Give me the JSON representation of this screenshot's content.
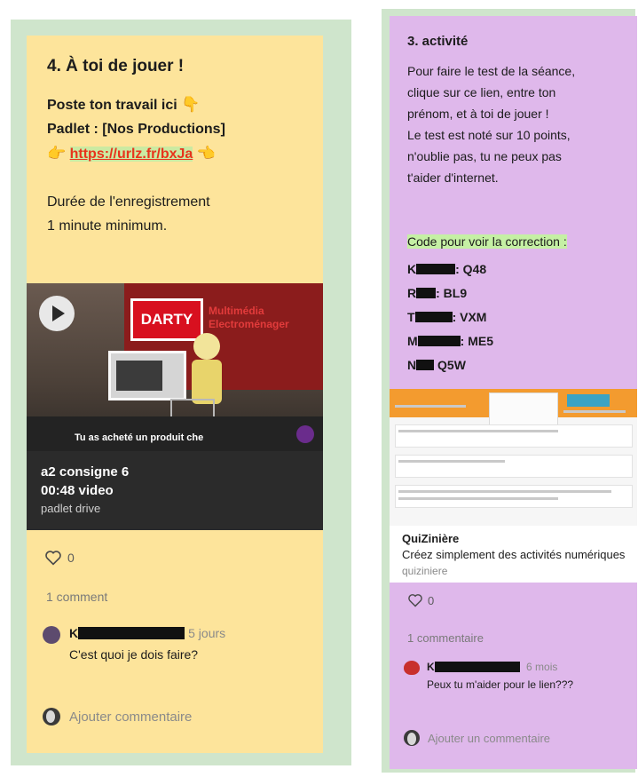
{
  "left_card": {
    "title": "4. À toi de jouer !",
    "line1": "Poste ton travail ici",
    "line2": "Padlet : [Nos Productions]",
    "link": "https://urlz.fr/bxJa",
    "duration_line1": "Durée de l'enregistrement",
    "duration_line2": "1 minute minimum.",
    "video": {
      "store_logo": "DARTY",
      "store_sub1": "Multimédia",
      "store_sub2": "Electroménager",
      "caption": "Tu as acheté un produit che",
      "title": "a2 consigne 6",
      "meta": "00:48 video",
      "source": "padlet drive"
    },
    "likes": "0",
    "comment_count": "1 comment",
    "comment": {
      "author_initial": "K",
      "time": "5 jours",
      "text": "C'est quoi je dois faire?"
    },
    "add_comment": "Ajouter commentaire"
  },
  "right_card": {
    "title": "3. activité",
    "body_lines": [
      "Pour faire le test de la séance,",
      "clique sur ce lien, entre ton",
      "prénom, et à toi de jouer !",
      "Le test est noté sur 10 points,",
      "n'oublie pas, tu ne peux pas",
      "t'aider d'internet."
    ],
    "codes_title": "Code pour voir la correction :",
    "codes": [
      {
        "initial": "K",
        "code": ": Q48"
      },
      {
        "initial": "R",
        "code": ": BL9"
      },
      {
        "initial": "T",
        "code": ": VXM"
      },
      {
        "initial": "M",
        "code": ": ME5"
      },
      {
        "initial": "N",
        "code": " Q5W"
      }
    ],
    "preview": {
      "title": "QuiZinière",
      "description": "Créez simplement des activités numériques",
      "domain": "quiziniere"
    },
    "likes": "0",
    "comment_count": "1 commentaire",
    "comment": {
      "author_initial": "K",
      "time": "6 mois",
      "text": "Peux tu m'aider pour le lien???"
    },
    "add_comment": "Ajouter un commentaire"
  },
  "colors": {
    "frame": "#cfe5cc",
    "left_card": "#fde49b",
    "right_card": "#dfb8eb",
    "link_text": "#e8341c",
    "link_highlight": "#cbeaa2",
    "codes_highlight": "#c5f0a4"
  },
  "icons": {
    "hand_down": "pointing-down-hand",
    "hand_right": "pointing-right-hand",
    "hand_left": "pointing-left-hand",
    "play": "play-icon",
    "heart": "heart-outline"
  }
}
